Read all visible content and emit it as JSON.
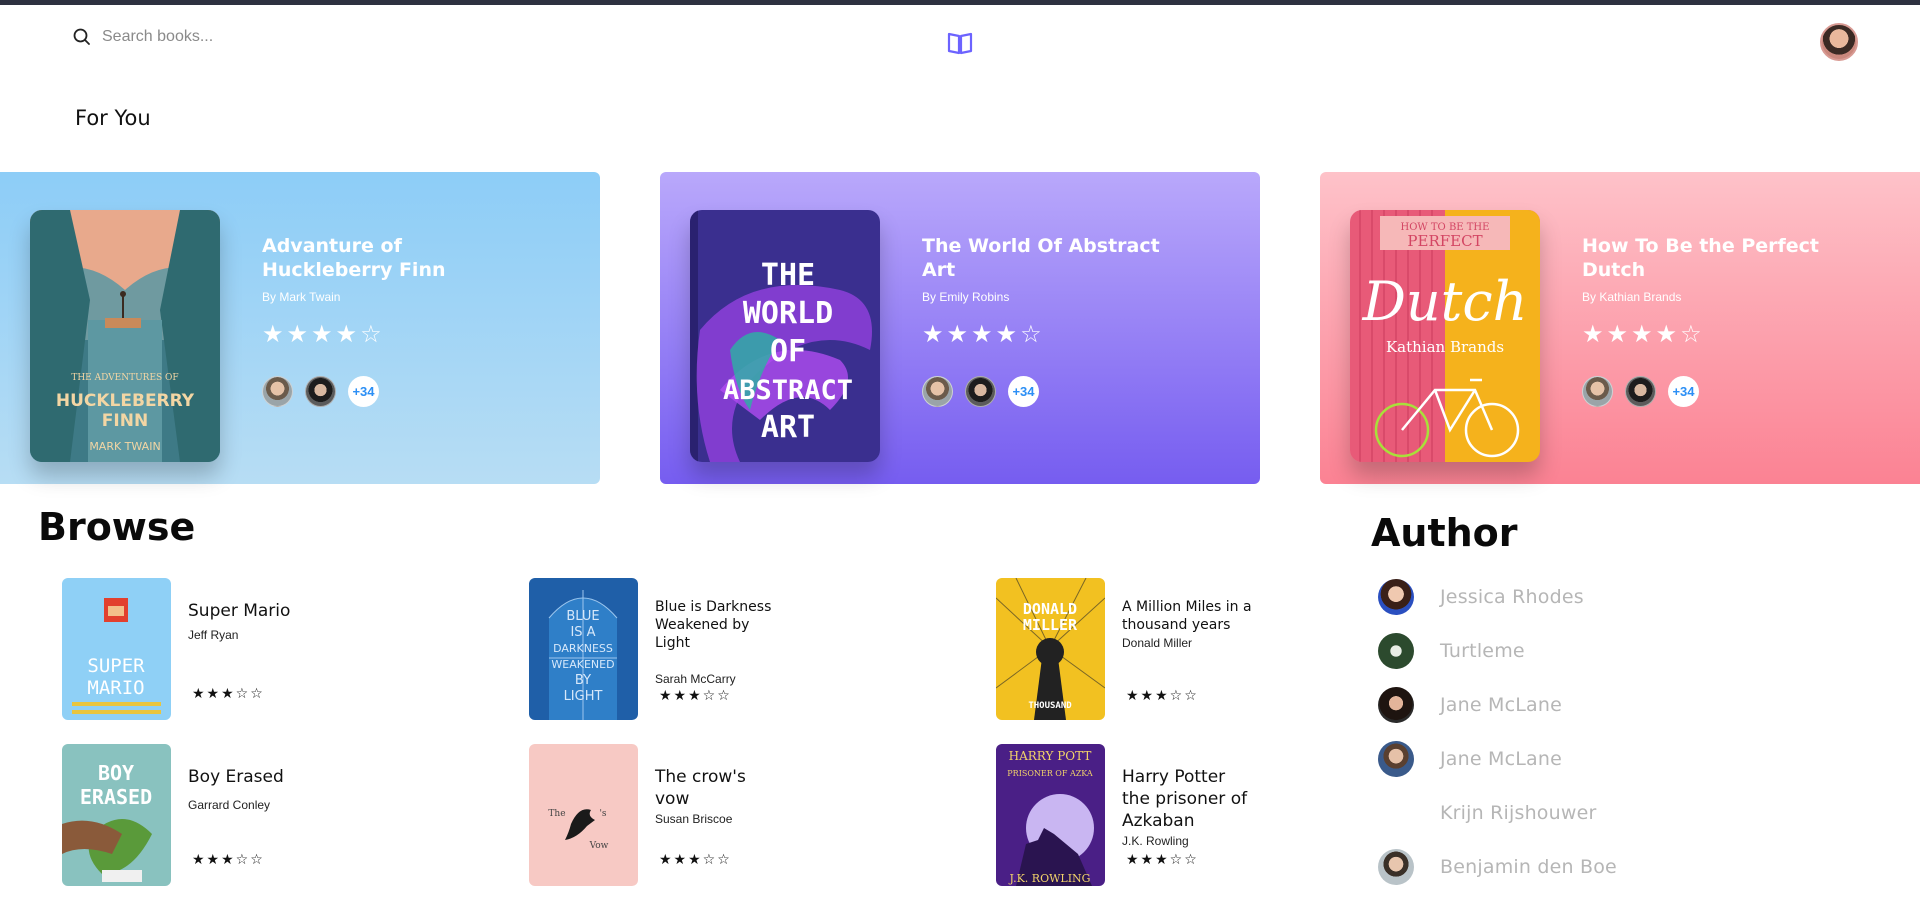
{
  "header": {
    "search_placeholder": "Search books...",
    "logo_icon": "open-book-icon",
    "accent_color": "#6c63ff"
  },
  "for_you": {
    "title": "For You",
    "cards": [
      {
        "title": "Advanture of Huckleberry Finn",
        "author": "By Mark Twain",
        "rating": 4,
        "stars": "★★★★☆",
        "readers_more": "+34",
        "cover_text": [
          "THE ADVENTURES OF",
          "HUCKLEBERRY FINN",
          "MARK TWAIN"
        ],
        "color": "#8dcdf7"
      },
      {
        "title": "The World Of Abstract Art",
        "author": "By Emily Robins",
        "rating": 4,
        "stars": "★★★★☆",
        "readers_more": "+34",
        "cover_text": [
          "THE",
          "WORLD",
          "OF",
          "ABSTRACT",
          "ART"
        ],
        "color": "#8f7af4"
      },
      {
        "title": "How To Be the Perfect Dutch",
        "author": "By Kathian Brands",
        "rating": 4,
        "stars": "★★★★☆",
        "readers_more": "+34",
        "cover_text": [
          "HOW TO BE THE",
          "PERFECT",
          "Dutch",
          "Kathian Brands"
        ],
        "color": "#fc94a3"
      }
    ]
  },
  "browse": {
    "title": "Browse",
    "books": [
      {
        "title": "Super Mario",
        "author": "Jeff Ryan",
        "rating": 3,
        "stars": "★★★☆☆",
        "cover_text": [
          "SUPER",
          "MARIO"
        ]
      },
      {
        "title": "Blue is Darkness Weakened by Light",
        "author": "Sarah McCarry",
        "rating": 3,
        "stars": "★★★☆☆",
        "cover_text": [
          "BLUE",
          "IS A",
          "DARKNESS",
          "WEAKENED",
          "BY",
          "LIGHT"
        ]
      },
      {
        "title": "A Million Miles in a thousand years",
        "author": "Donald Miller",
        "rating": 3,
        "stars": "★★★☆☆",
        "cover_text": [
          "DONALD",
          "MILLER",
          "THOUSAND"
        ]
      },
      {
        "title": "Boy Erased",
        "author": "Garrard Conley",
        "rating": 3,
        "stars": "★★★☆☆",
        "cover_text": [
          "BOY",
          "ERASED"
        ]
      },
      {
        "title": "The crow's vow",
        "author": "Susan Briscoe",
        "rating": 3,
        "stars": "★★★☆☆",
        "cover_text": [
          "The",
          "'s",
          "Vow"
        ]
      },
      {
        "title": "Harry Potter the prisoner of Azkaban",
        "author": "J.K. Rowling",
        "rating": 3,
        "stars": "★★★☆☆",
        "cover_text": [
          "HARRY POTT",
          "PRISONER OF AZKA",
          "J.K. ROWLING"
        ]
      }
    ]
  },
  "authors": {
    "title": "Author",
    "list": [
      {
        "name": "Jessica Rhodes",
        "avatar": "portrait-woman"
      },
      {
        "name": "Turtleme",
        "avatar": "turtle-logo"
      },
      {
        "name": "Jane McLane",
        "avatar": "portrait-woman-dark"
      },
      {
        "name": "Jane McLane",
        "avatar": "portrait-man"
      },
      {
        "name": "Krijn Rijshouwer",
        "avatar": "none"
      },
      {
        "name": "Benjamin den Boe",
        "avatar": "portrait-man-2"
      }
    ]
  }
}
